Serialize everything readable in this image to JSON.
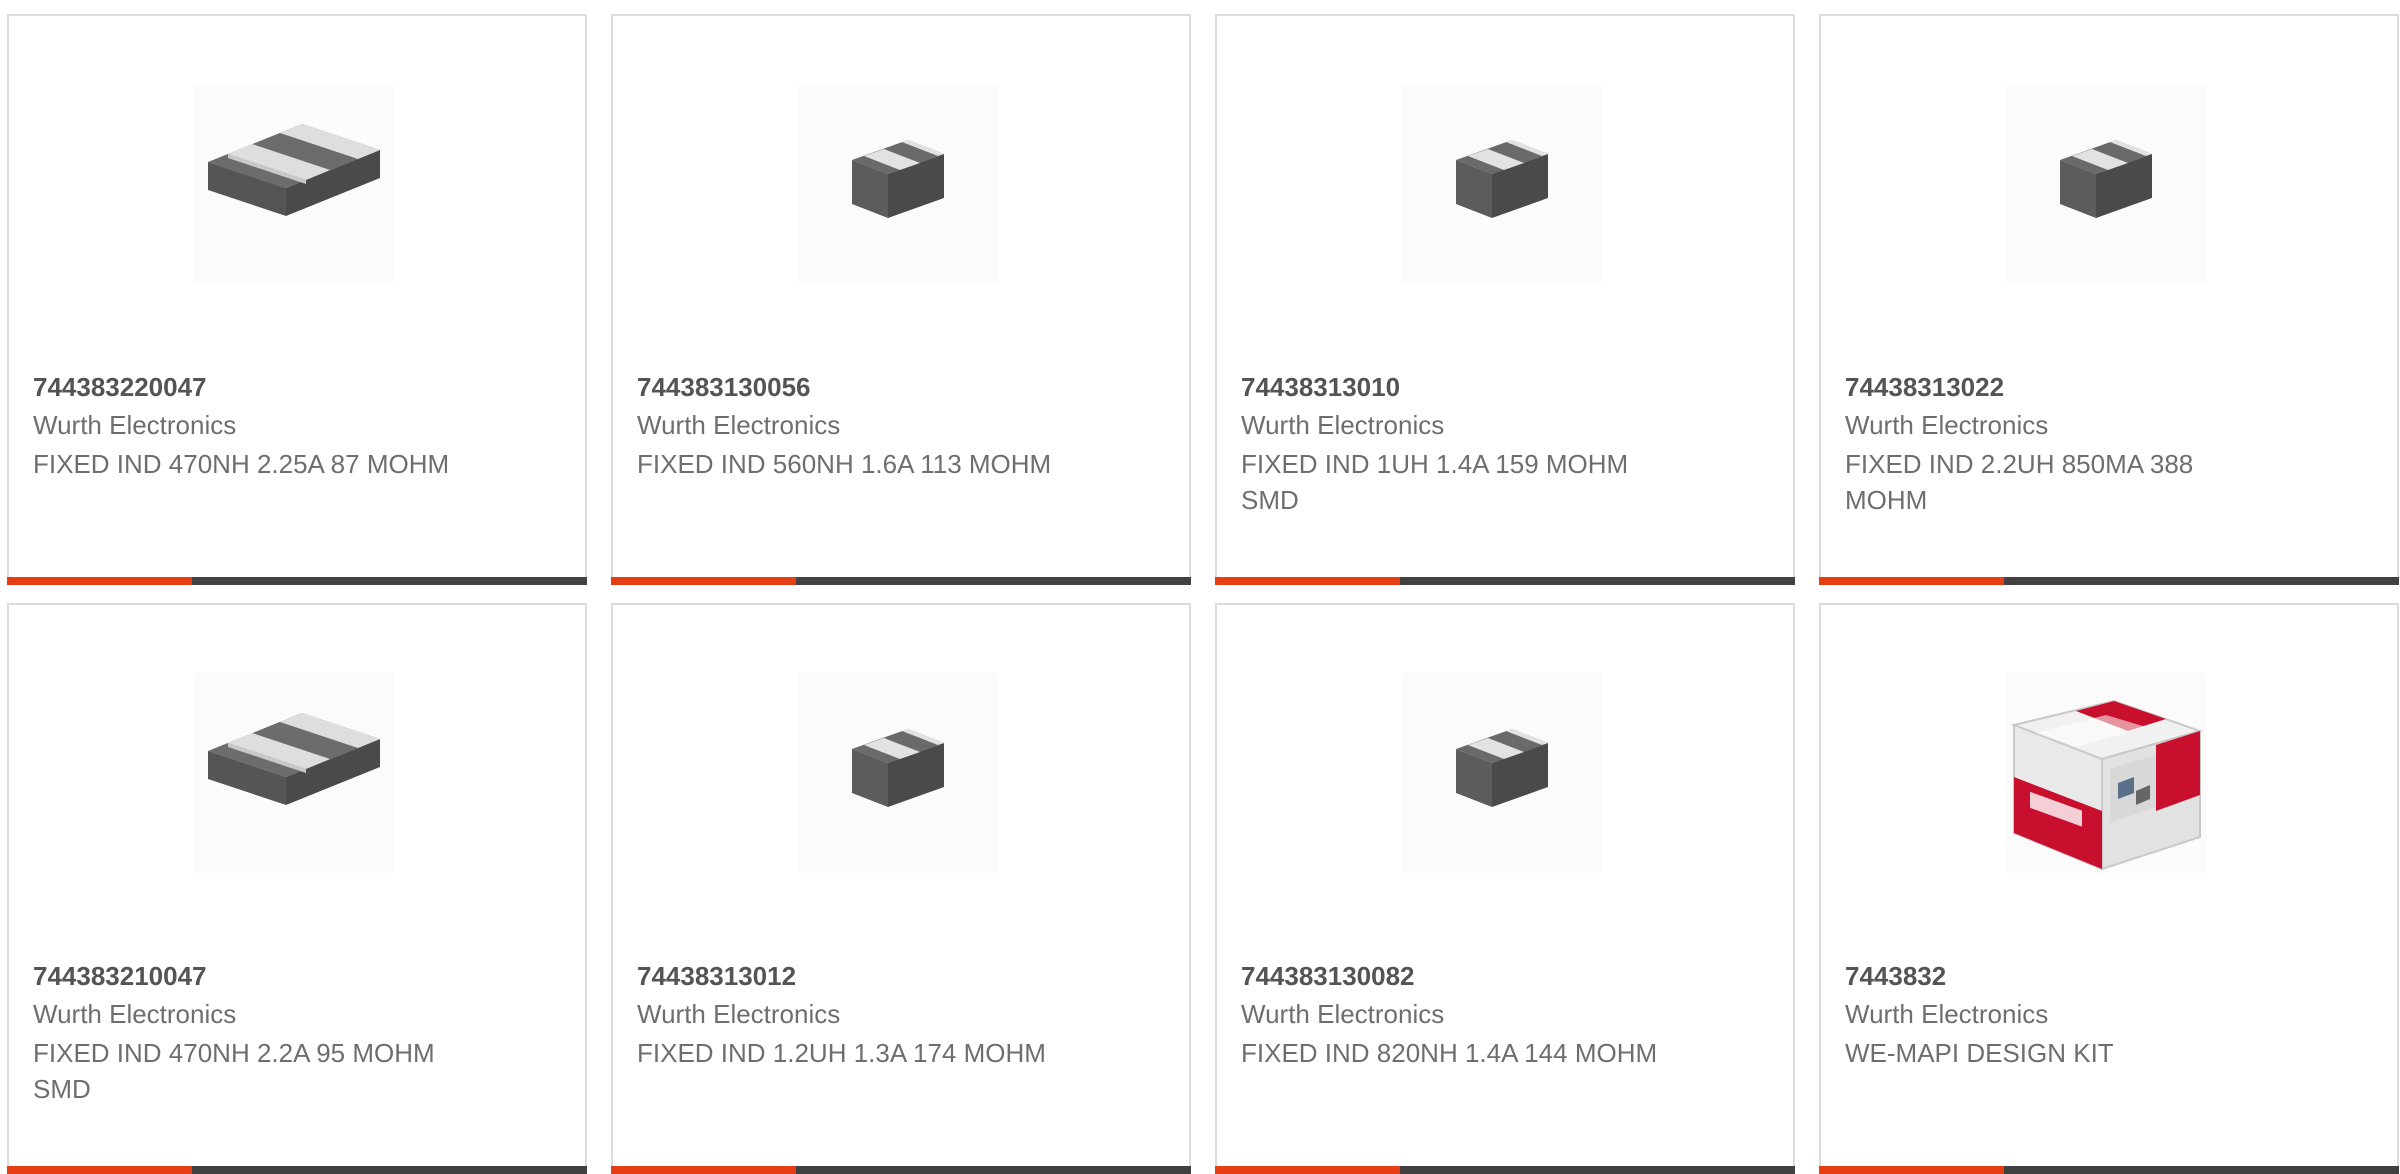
{
  "products": [
    {
      "part_number": "744383220047",
      "manufacturer": "Wurth Electronics",
      "description": "FIXED IND 470NH 2.25A 87 MOHM",
      "image": "large-inductor-image"
    },
    {
      "part_number": "744383130056",
      "manufacturer": "Wurth Electronics",
      "description": "FIXED IND 560NH 1.6A 113 MOHM",
      "image": "small-inductor-image"
    },
    {
      "part_number": "74438313010",
      "manufacturer": "Wurth Electronics",
      "description": "FIXED IND 1UH 1.4A 159 MOHM SMD",
      "image": "small-inductor-image"
    },
    {
      "part_number": "74438313022",
      "manufacturer": "Wurth Electronics",
      "description": "FIXED IND 2.2UH 850MA 388 MOHM",
      "image": "small-inductor-image"
    },
    {
      "part_number": "744383210047",
      "manufacturer": "Wurth Electronics",
      "description": "FIXED IND 470NH 2.2A 95 MOHM SMD",
      "image": "large-inductor-image"
    },
    {
      "part_number": "74438313012",
      "manufacturer": "Wurth Electronics",
      "description": "FIXED IND 1.2UH 1.3A 174 MOHM",
      "image": "small-inductor-image"
    },
    {
      "part_number": "744383130082",
      "manufacturer": "Wurth Electronics",
      "description": "FIXED IND 820NH 1.4A 144 MOHM",
      "image": "small-inductor-image"
    },
    {
      "part_number": "7443832",
      "manufacturer": "Wurth Electronics",
      "description": "WE-MAPI DESIGN KIT",
      "image": "design-kit-box-image"
    }
  ],
  "colors": {
    "accent": "#e43e12",
    "bar": "#414141",
    "border": "#dcdcdc",
    "part_number_text": "#545454",
    "secondary_text": "#6e6e6e"
  }
}
